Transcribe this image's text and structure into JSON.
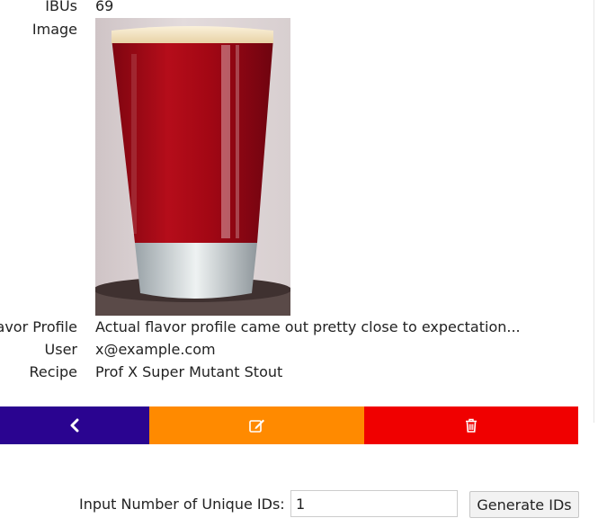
{
  "details": {
    "ibus_label": "IBUs",
    "ibus_value": "69",
    "image_label": "Image",
    "flavor_label": "Flavor Profile",
    "flavor_value": "Actual flavor profile came out pretty close to expectation...",
    "user_label": "User",
    "user_value": "x@example.com",
    "recipe_label": "Recipe",
    "recipe_value": "Prof X Super Mutant Stout"
  },
  "actions": {
    "back_icon": "chevron-left-icon",
    "edit_icon": "edit-icon",
    "delete_icon": "trash-icon",
    "back_color": "#2a0490",
    "edit_color": "#ff8a00",
    "delete_color": "#f00000"
  },
  "generator": {
    "label": "Input Number of Unique IDs:",
    "input_value": "1",
    "button_label": "Generate IDs"
  }
}
